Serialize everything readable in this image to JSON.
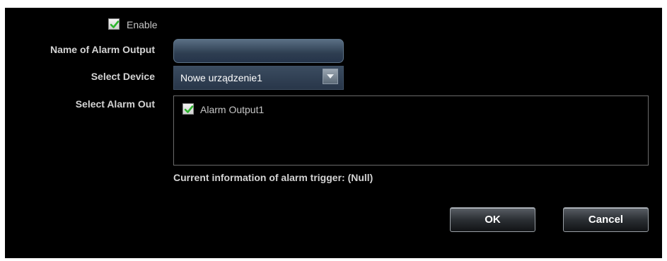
{
  "enable": {
    "label": "Enable",
    "checked": true
  },
  "fields": {
    "name_label": "Name of Alarm Output",
    "name_value": "",
    "device_label": "Select Device",
    "device_value": "Nowe urządzenie1",
    "alarm_out_label": "Select Alarm Out"
  },
  "alarm_outputs": [
    {
      "label": "Alarm Output1",
      "checked": true
    }
  ],
  "info_text": "Current information of alarm trigger: (Null)",
  "buttons": {
    "ok": "OK",
    "cancel": "Cancel"
  },
  "colors": {
    "panel_bg": "#000000",
    "check_green": "#2db52d",
    "input_bg": "#2e3e51"
  },
  "icons": {
    "checkbox": "checkmark-icon",
    "dropdown": "chevron-down-icon"
  }
}
